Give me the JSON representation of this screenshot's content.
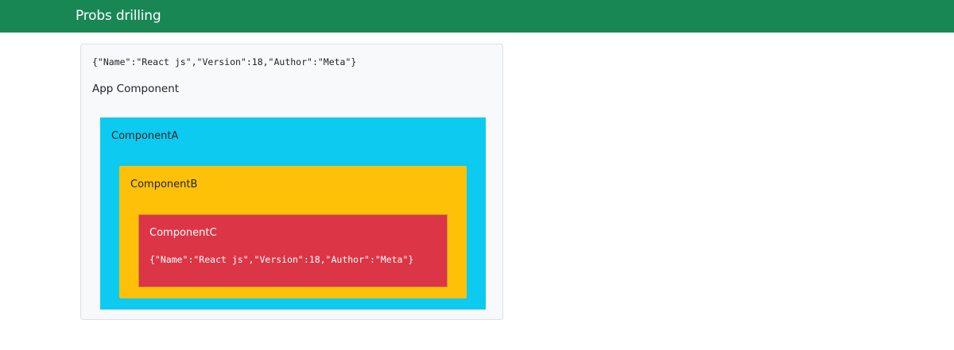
{
  "navbar": {
    "brand": "Probs drilling",
    "color": "#198754"
  },
  "app": {
    "json_display": "{\"Name\":\"React js\",\"Version\":18,\"Author\":\"Meta\"}",
    "title": "App Component",
    "background": "#f8f9fa"
  },
  "component_a": {
    "label": "ComponentA",
    "color": "#0dcaf0"
  },
  "component_b": {
    "label": "ComponentB",
    "color": "#ffc107"
  },
  "component_c": {
    "label": "ComponentC",
    "json_display": "{\"Name\":\"React js\",\"Version\":18,\"Author\":\"Meta\"}",
    "color": "#dc3545"
  }
}
